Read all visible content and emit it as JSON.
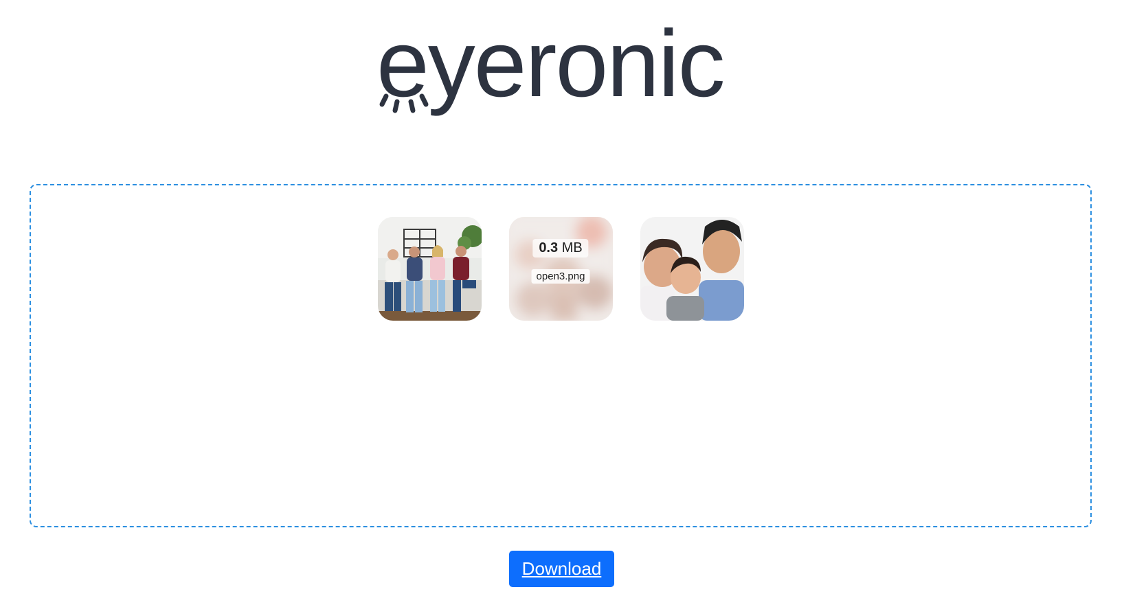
{
  "logo": {
    "text": "eyeronic",
    "color": "#2d3340"
  },
  "dropzone": {
    "border_color": "#2c8fe0",
    "files": [
      {
        "kind": "image",
        "subject": "four-friends-on-sofa"
      },
      {
        "kind": "image",
        "size_value": "0.3",
        "size_unit": "MB",
        "filename": "open3.png",
        "state": "hover-details"
      },
      {
        "kind": "image",
        "subject": "grandparents-with-child"
      }
    ]
  },
  "actions": {
    "download_label": "Download",
    "download_color": "#0d6efd"
  }
}
